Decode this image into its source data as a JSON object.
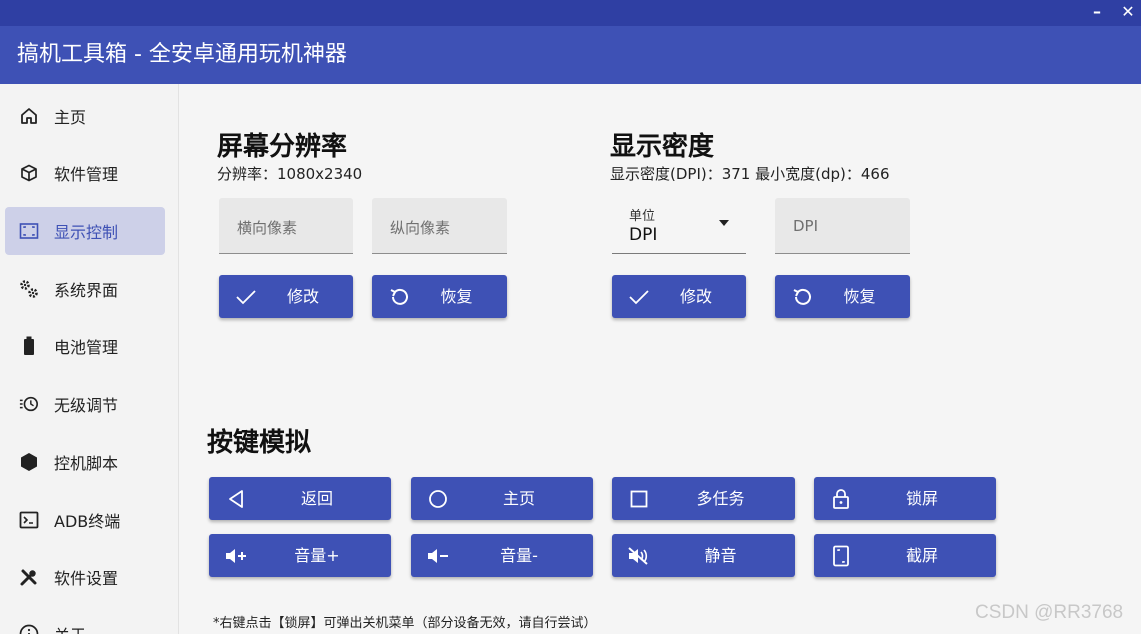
{
  "window": {
    "minimize": "–",
    "close": "✕"
  },
  "app_title": "搞机工具箱 - 全安卓通用玩机神器",
  "sidebar": {
    "items": [
      {
        "label": "主页",
        "icon": "home-icon"
      },
      {
        "label": "软件管理",
        "icon": "package-icon"
      },
      {
        "label": "显示控制",
        "icon": "screen-icon",
        "active": true
      },
      {
        "label": "系统界面",
        "icon": "gears-icon"
      },
      {
        "label": "电池管理",
        "icon": "battery-icon"
      },
      {
        "label": "无级调节",
        "icon": "timer-icon"
      },
      {
        "label": "控机脚本",
        "icon": "hexagon-icon"
      },
      {
        "label": "ADB终端",
        "icon": "terminal-icon"
      },
      {
        "label": "软件设置",
        "icon": "tools-icon"
      },
      {
        "label": "关于",
        "icon": "info-icon"
      }
    ]
  },
  "resolution": {
    "title": "屏幕分辨率",
    "info": "分辨率：1080x2340",
    "width_placeholder": "横向像素",
    "height_placeholder": "纵向像素",
    "apply_label": "修改",
    "reset_label": "恢复"
  },
  "density": {
    "title": "显示密度",
    "info": "显示密度(DPI)：371   最小宽度(dp)：466",
    "unit_label": "单位",
    "unit_value": "DPI",
    "dpi_placeholder": "DPI",
    "apply_label": "修改",
    "reset_label": "恢复"
  },
  "keys": {
    "title": "按键模拟",
    "buttons": [
      {
        "label": "返回",
        "icon": "back-triangle-icon"
      },
      {
        "label": "主页",
        "icon": "home-circle-icon"
      },
      {
        "label": "多任务",
        "icon": "recents-square-icon"
      },
      {
        "label": "锁屏",
        "icon": "lock-icon"
      },
      {
        "label": "音量+",
        "icon": "volume-up-icon"
      },
      {
        "label": "音量-",
        "icon": "volume-down-icon"
      },
      {
        "label": "静音",
        "icon": "mute-icon"
      },
      {
        "label": "截屏",
        "icon": "screenshot-icon"
      }
    ],
    "footnote": "*右键点击【锁屏】可弹出关机菜单（部分设备无效，请自行尝试）"
  },
  "watermark": "CSDN @RR3768",
  "colors": {
    "primary": "#3e51b5",
    "titlebar": "#2f3fa3",
    "active_nav": "#cdd0e8"
  }
}
